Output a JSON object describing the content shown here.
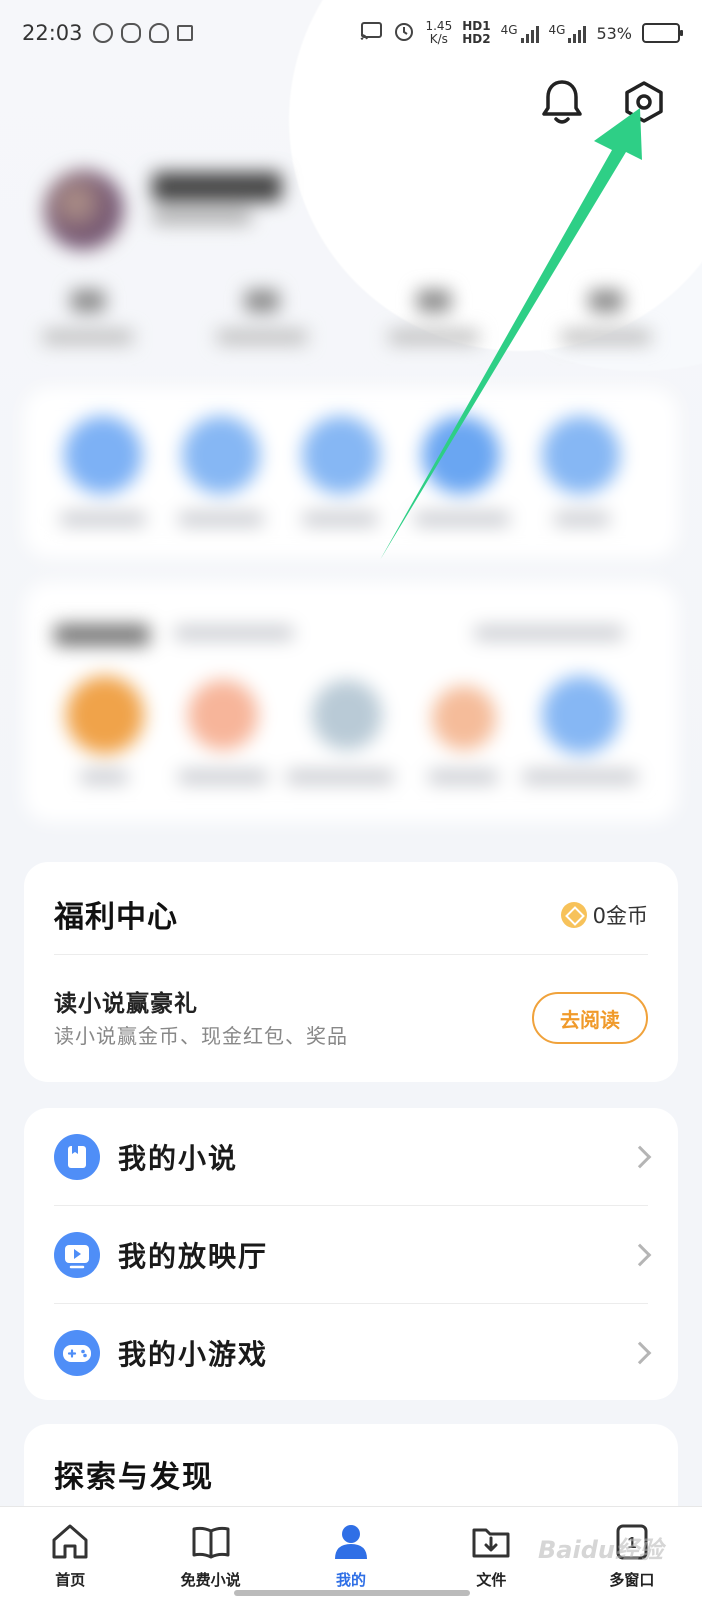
{
  "status_bar": {
    "time": "22:03",
    "speed_value": "1.45",
    "speed_unit": "K/s",
    "hd1": "HD1",
    "hd2": "HD2",
    "net1": "4G",
    "net2": "4G",
    "battery_percent": "53%",
    "battery_level": 0.53
  },
  "header": {
    "notifications_icon": "bell-icon",
    "settings_icon": "gear-icon"
  },
  "welfare": {
    "title": "福利中心",
    "coin_icon": "coin-icon",
    "coins_label": "0金币",
    "promo_title": "读小说赢豪礼",
    "promo_subtitle": "读小说赢金币、现金红包、奖品",
    "action_label": "去阅读",
    "accent": "#f0a23b"
  },
  "menu": {
    "items": [
      {
        "label": "我的小说",
        "icon": "book-icon"
      },
      {
        "label": "我的放映厅",
        "icon": "play-icon"
      },
      {
        "label": "我的小游戏",
        "icon": "gamepad-icon"
      }
    ],
    "icon_color": "#4f8ef7"
  },
  "explore": {
    "title": "探索与发现"
  },
  "tab_bar": {
    "tabs": [
      {
        "label": "首页",
        "icon": "home-icon"
      },
      {
        "label": "免费小说",
        "icon": "open-book-icon"
      },
      {
        "label": "我的",
        "icon": "person-icon"
      },
      {
        "label": "文件",
        "icon": "download-folder-icon"
      },
      {
        "label": "多窗口",
        "icon": "windows-icon",
        "badge": "1"
      }
    ],
    "active_color": "#2f6fe6"
  },
  "annotation": {
    "arrow_color": "#2ecf86",
    "watermark": "Baidu经验"
  }
}
